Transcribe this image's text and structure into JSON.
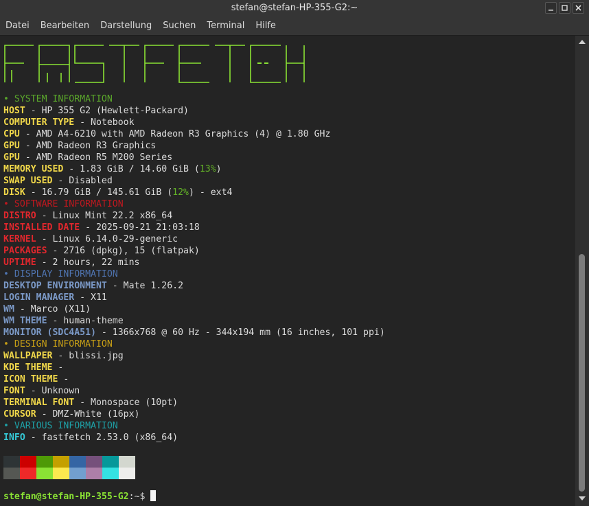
{
  "window": {
    "title": "stefan@stefan-HP-355-G2:~",
    "controls": [
      "minimize",
      "maximize",
      "close"
    ]
  },
  "menu": [
    "Datei",
    "Bearbeiten",
    "Darstellung",
    "Suchen",
    "Terminal",
    "Hilfe"
  ],
  "colors": {
    "yellow": "#f0d74a",
    "red": "#e0272d",
    "blue": "#7b99c7",
    "cyan": "#36c9d6",
    "green": "#63b227",
    "logo": "#8ae234"
  },
  "logo_text": "FASTFETCH",
  "sections": {
    "system": "• SYSTEM INFORMATION",
    "software": "• SOFTWARE INFORMATION",
    "display": "• DISPLAY INFORMATION",
    "design": "• DESIGN INFORMATION",
    "various": "• VARIOUS INFORMATION"
  },
  "info": {
    "host": {
      "key": "HOST",
      "value": " - HP 355 G2 (Hewlett-Packard)"
    },
    "computer_type": {
      "key": "COMPUTER TYPE",
      "value": " - Notebook"
    },
    "cpu": {
      "key": "CPU",
      "value": " - AMD A4-6210 with AMD Radeon R3 Graphics (4) @ 1.80 GHz"
    },
    "gpu1": {
      "key": "GPU",
      "value": " - AMD Radeon R3 Graphics"
    },
    "gpu2": {
      "key": "GPU",
      "value": " - AMD Radeon R5 M200 Series"
    },
    "memory": {
      "key": "MEMORY USED",
      "value": " - 1.83 GiB / 14.60 GiB (",
      "pct": "13%",
      "tail": ")"
    },
    "swap": {
      "key": "SWAP USED",
      "value": " - Disabled"
    },
    "disk": {
      "key": "DISK",
      "value": " - 16.79 GiB / 145.61 GiB (",
      "pct": "12%",
      "tail": ") - ext4"
    },
    "distro": {
      "key": "DISTRO",
      "value": " - Linux Mint 22.2 x86_64"
    },
    "installed": {
      "key": "INSTALLED DATE",
      "value": " - 2025-09-21 21:03:18"
    },
    "kernel": {
      "key": "KERNEL",
      "value": " - Linux 6.14.0-29-generic"
    },
    "packages": {
      "key": "PACKAGES",
      "value": " - 2716 (dpkg), 15 (flatpak)"
    },
    "uptime": {
      "key": "UPTIME",
      "value": " - 2 hours, 22 mins"
    },
    "de": {
      "key": "DESKTOP ENVIRONMENT",
      "value": " - Mate 1.26.2"
    },
    "login": {
      "key": "LOGIN MANAGER",
      "value": " - X11"
    },
    "wm": {
      "key": "WM",
      "value": " - Marco (X11)"
    },
    "wm_theme": {
      "key": "WM THEME",
      "value": " - human-theme"
    },
    "monitor": {
      "key": "MONITOR (SDC4A51)",
      "value": " - 1366x768 @ 60 Hz - 344x194 mm (16 inches, 101 ppi)"
    },
    "wallpaper": {
      "key": "WALLPAPER",
      "value": " - blissi.jpg"
    },
    "kde_theme": {
      "key": "KDE THEME",
      "value": " -"
    },
    "icon_theme": {
      "key": "ICON THEME",
      "value": " -"
    },
    "font": {
      "key": "FONT",
      "value": " - Unknown"
    },
    "terminal_font": {
      "key": "TERMINAL FONT",
      "value": " - Monospace (10pt)"
    },
    "cursor": {
      "key": "CURSOR",
      "value": " - DMZ-White (16px)"
    },
    "info": {
      "key": "INFO",
      "value": " - fastfetch 2.53.0 (x86_64)"
    }
  },
  "palette": {
    "top": [
      "#2e3436",
      "#cc0000",
      "#4e9a06",
      "#c4a000",
      "#3465a4",
      "#75507b",
      "#06989a",
      "#d3d7cf"
    ],
    "bottom": [
      "#555753",
      "#ef2929",
      "#8ae234",
      "#fce94f",
      "#729fcf",
      "#ad7fa8",
      "#34e2e2",
      "#eeeeec"
    ]
  },
  "prompt": {
    "user_host": "stefan@stefan-HP-355-G2",
    "path": ":~",
    "symbol": "$"
  }
}
